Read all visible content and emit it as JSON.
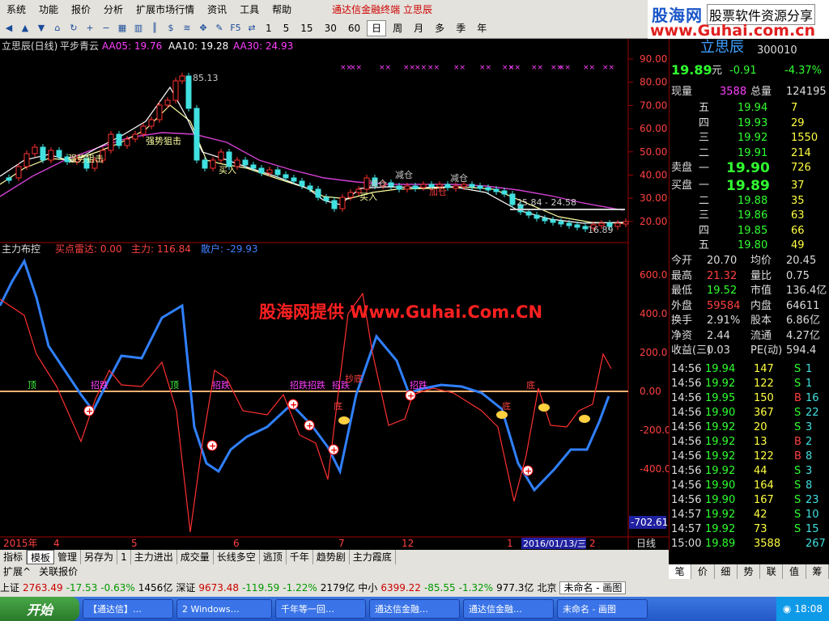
{
  "menu": [
    "系统",
    "功能",
    "报价",
    "分析",
    "扩展市场行情",
    "资讯",
    "工具",
    "帮助"
  ],
  "menu_title": "通达信金融终端 立思辰",
  "toolbar": {
    "periods": [
      "1",
      "5",
      "15",
      "30",
      "60",
      "日",
      "周",
      "月",
      "多",
      "季",
      "年"
    ],
    "active_period": "日"
  },
  "logo": {
    "name": "股海网",
    "tagline": "股票软件资源分享",
    "url": "www.Guhai.com.cn"
  },
  "main_chart": {
    "title": "立思辰(日线)",
    "indicator": "平步青云",
    "legend": [
      {
        "text": "AA05: 19.76",
        "color": "#ff40ff"
      },
      {
        "text": "AA10: 19.28",
        "color": "#ffffff"
      },
      {
        "text": "AA30: 24.93",
        "color": "#ff40ff"
      }
    ],
    "price_axis": [
      "90.00",
      "80.00",
      "70.00",
      "60.00",
      "50.00",
      "40.00",
      "30.00",
      "20.00"
    ],
    "annotations": [
      "85.13",
      "强势狙击",
      "强势狙击",
      "买入",
      "减仓",
      "减仓",
      "减仓",
      "买入",
      "加仓",
      "25.84 - 24.58",
      "16.89"
    ]
  },
  "sub_chart": {
    "title": "主力布控",
    "legend": [
      {
        "text": "买点雷达: 0.00",
        "color": "#ff4040"
      },
      {
        "text": "主力: 116.84",
        "color": "#ff4040"
      },
      {
        "text": "散户: -29.93",
        "color": "#4080ff"
      }
    ],
    "axis": [
      "600.0",
      "400.0",
      "200.0",
      "0.00",
      "-200.0",
      "-400.0"
    ],
    "readout": "-702.61",
    "labels": [
      "顶",
      "招跌",
      "顶",
      "招跌",
      "招跌",
      "招跌",
      "招跌",
      "抄底",
      "底",
      "招跌",
      "底",
      "底"
    ],
    "watermark": "股海网提供 Www.Guhai.Com.CN"
  },
  "date_axis": {
    "labels": [
      "2015年",
      "4",
      "5",
      "6",
      "7",
      "12",
      "1",
      "2"
    ],
    "highlight": "2016/01/13/三",
    "period_label": "日线"
  },
  "quote": {
    "name": "立思辰",
    "code": "300010",
    "price": "19.89",
    "unit": "元",
    "change": "-0.91",
    "pct": "-4.37%",
    "current_vol_label": "现量",
    "current_vol": "3588",
    "total_vol_label": "总量",
    "total_vol": "124195",
    "sell_label": "卖盘",
    "buy_label": "买盘",
    "sells": [
      {
        "level": "五",
        "price": "19.94",
        "vol": "7"
      },
      {
        "level": "四",
        "price": "19.93",
        "vol": "29"
      },
      {
        "level": "三",
        "price": "19.92",
        "vol": "1550"
      },
      {
        "level": "二",
        "price": "19.91",
        "vol": "214"
      },
      {
        "level": "一",
        "price": "19.90",
        "vol": "726"
      }
    ],
    "buys": [
      {
        "level": "一",
        "price": "19.89",
        "vol": "37"
      },
      {
        "level": "二",
        "price": "19.88",
        "vol": "35"
      },
      {
        "level": "三",
        "price": "19.86",
        "vol": "63"
      },
      {
        "level": "四",
        "price": "19.85",
        "vol": "66"
      },
      {
        "level": "五",
        "price": "19.80",
        "vol": "49"
      }
    ],
    "stats": [
      [
        "今开",
        "20.70",
        "均价",
        "20.45"
      ],
      [
        "最高",
        "21.32",
        "量比",
        "0.75"
      ],
      [
        "最低",
        "19.52",
        "市值",
        "136.4亿"
      ],
      [
        "外盘",
        "59584",
        "内盘",
        "64611"
      ],
      [
        "换手",
        "2.91%",
        "股本",
        "6.86亿"
      ],
      [
        "净资",
        "2.44",
        "流通",
        "4.27亿"
      ],
      [
        "收益(三)",
        "0.03",
        "PE(动)",
        "594.4"
      ]
    ],
    "ticks": [
      [
        "14:56",
        "19.94",
        "147",
        "S",
        "1"
      ],
      [
        "14:56",
        "19.92",
        "122",
        "S",
        "1"
      ],
      [
        "14:56",
        "19.95",
        "150",
        "B",
        "16"
      ],
      [
        "14:56",
        "19.90",
        "367",
        "S",
        "22"
      ],
      [
        "14:56",
        "19.92",
        "20",
        "S",
        "3"
      ],
      [
        "14:56",
        "19.92",
        "13",
        "B",
        "2"
      ],
      [
        "14:56",
        "19.92",
        "122",
        "B",
        "8"
      ],
      [
        "14:56",
        "19.92",
        "44",
        "S",
        "3"
      ],
      [
        "14:56",
        "19.90",
        "164",
        "S",
        "8"
      ],
      [
        "14:56",
        "19.90",
        "167",
        "S",
        "23"
      ],
      [
        "14:57",
        "19.92",
        "42",
        "S",
        "10"
      ],
      [
        "14:57",
        "19.92",
        "73",
        "S",
        "15"
      ],
      [
        "15:00",
        "19.89",
        "3588",
        "",
        "267"
      ]
    ],
    "tabs": [
      "笔",
      "价",
      "细",
      "势",
      "联",
      "值",
      "筹"
    ]
  },
  "bottom_tabs": [
    "指标",
    "模板",
    "管理",
    "另存为",
    "1",
    "主力进出",
    "成交量",
    "长线多空",
    "逃顶",
    "千年",
    "趋势剧",
    "主力霞底"
  ],
  "bottom_tabs_active": "模板",
  "bottom2": [
    "扩展^",
    "关联报价"
  ],
  "ticker": [
    {
      "label": "上证",
      "value": "2763.49",
      "chg": "-17.53",
      "pct": "-0.63%",
      "amt": "1456亿"
    },
    {
      "label": "深证",
      "value": "9673.48",
      "chg": "-119.59",
      "pct": "-1.22%",
      "amt": "2179亿"
    },
    {
      "label": "中小",
      "value": "6399.22",
      "chg": "-85.55",
      "pct": "-1.32%",
      "amt": "977.3亿"
    }
  ],
  "ticker_city": "北京",
  "ticker_input": "未命名 - 画图",
  "taskbar": {
    "start": "开始",
    "tasks": [
      "【通达信】…",
      "2 Windows…",
      "千年等一回…",
      "通达信金融…",
      "通达信金融…",
      "未命名 - 画图"
    ],
    "clock": "18:08"
  }
}
